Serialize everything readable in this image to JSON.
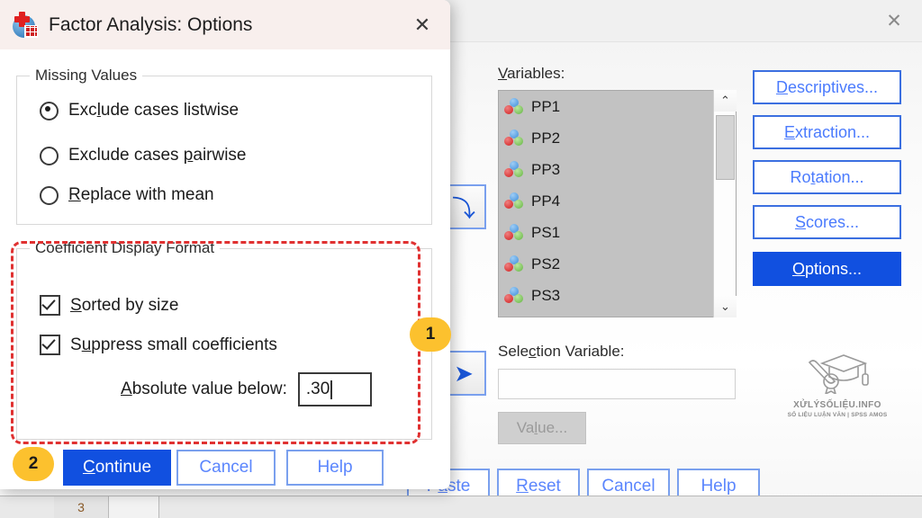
{
  "background_window": {
    "close_label": "✕",
    "variables": {
      "label": "Variables:",
      "items": [
        "PP1",
        "PP2",
        "PP3",
        "PP4",
        "PS1",
        "PS2",
        "PS3"
      ],
      "scroll_up_glyph": "⌃",
      "scroll_down_glyph": "⌄"
    },
    "selection_variable": {
      "label": "Selection Variable:",
      "value": "",
      "value_button": "Value..."
    },
    "side_buttons": [
      {
        "label": "Descriptives...",
        "mnemonic": "D",
        "active": false
      },
      {
        "label": "Extraction...",
        "mnemonic": "E",
        "active": false
      },
      {
        "label": "Rotation...",
        "mnemonic": "t",
        "active": false
      },
      {
        "label": "Scores...",
        "mnemonic": "S",
        "active": false
      },
      {
        "label": "Options...",
        "mnemonic": "O",
        "active": true
      }
    ],
    "arrow_buttons": [
      {
        "name": "move-up-arrow",
        "glyph": "⤵"
      },
      {
        "name": "move-right-arrow",
        "glyph": "➤"
      }
    ],
    "bottom_buttons": [
      {
        "label": "Paste",
        "mnemonic": "P"
      },
      {
        "label": "Reset",
        "mnemonic": "R"
      },
      {
        "label": "Cancel",
        "mnemonic": ""
      },
      {
        "label": "Help",
        "mnemonic": ""
      }
    ],
    "data_grid": {
      "row_number": "3"
    },
    "watermark": {
      "title": "XỬLÝSỐLIỆU.INFO",
      "subtitle": "SỐ LIỆU LUẬN VĂN | SPSS AMOS"
    }
  },
  "options_dialog": {
    "title": "Factor Analysis: Options",
    "icon": "spss-app-icon",
    "close_label": "✕",
    "missing_values": {
      "group_title": "Missing Values",
      "options": [
        {
          "label": "Exclude cases listwise",
          "selected": true
        },
        {
          "label": "Exclude cases pairwise",
          "selected": false
        },
        {
          "label": "Replace with mean",
          "selected": false
        }
      ]
    },
    "coefficient_display_format": {
      "group_title": "Coefficient Display Format",
      "options": [
        {
          "label": "Sorted by size",
          "checked": true
        },
        {
          "label": "Suppress small coefficients",
          "checked": true
        }
      ],
      "absolute_value_label": "Absolute value below:",
      "absolute_value": ".30"
    },
    "buttons": [
      {
        "label": "Continue",
        "primary": true
      },
      {
        "label": "Cancel",
        "primary": false
      },
      {
        "label": "Help",
        "primary": false
      }
    ]
  },
  "callouts": [
    {
      "number": "1"
    },
    {
      "number": "2"
    }
  ],
  "colors": {
    "primary_blue": "#1150e0",
    "button_blue_text": "#5b86fd",
    "badge_amber": "#fcc12e",
    "highlight_red": "#e03131",
    "list_disabled_bg": "#c2c2c2",
    "dialog_titlebar": "#f8efed"
  }
}
